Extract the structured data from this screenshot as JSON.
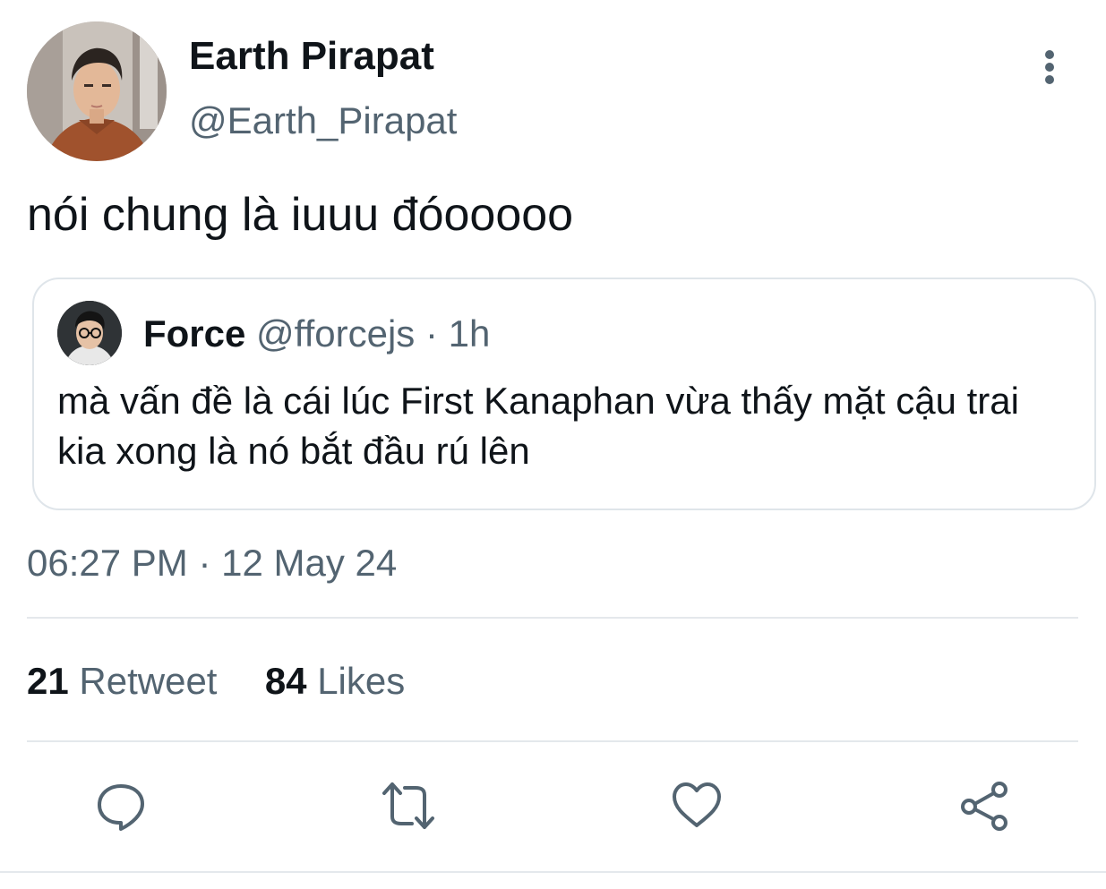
{
  "tweet": {
    "author": {
      "name": "Earth Pirapat",
      "handle": "@Earth_Pirapat"
    },
    "text": "nói chung là iuuu đóooooo",
    "quoted": {
      "name": "Force",
      "handle": "@fforcejs",
      "separator": "·",
      "time": "1h",
      "text": "mà vấn đề là cái lúc First Kanaphan vừa thấy mặt cậu trai kia xong là nó bắt đầu rú lên"
    },
    "timestamp": "06:27 PM · 12 May 24",
    "stats": {
      "retweets_count": "21",
      "retweets_label": "Retweet",
      "likes_count": "84",
      "likes_label": "Likes"
    }
  },
  "actions": [
    {
      "icon": "reply-icon"
    },
    {
      "icon": "retweet-icon"
    },
    {
      "icon": "like-icon"
    },
    {
      "icon": "share-icon"
    }
  ],
  "colors": {
    "text_primary": "#0f1419",
    "text_secondary": "#536471",
    "border": "#dfe5ea"
  }
}
